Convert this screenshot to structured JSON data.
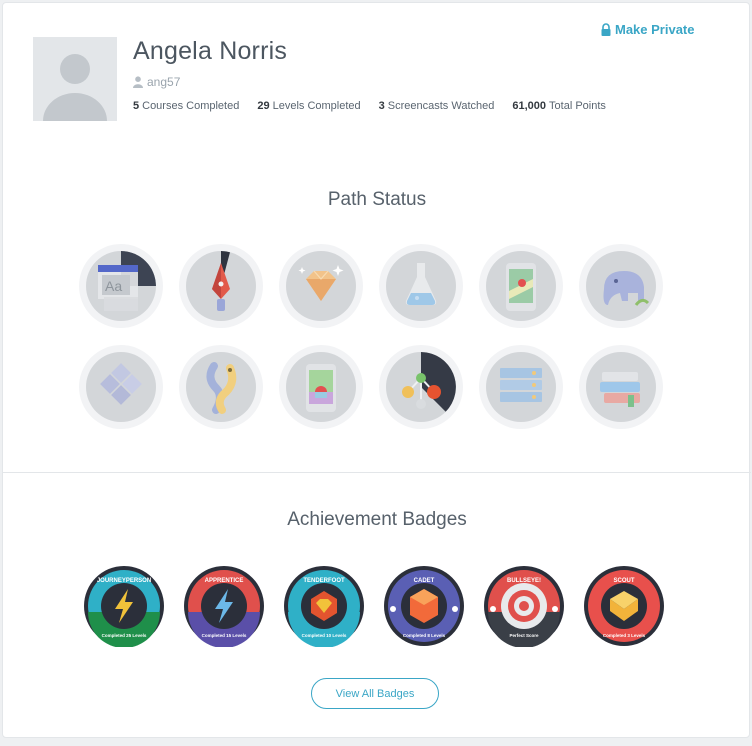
{
  "profile": {
    "name": "Angela Norris",
    "username": "ang57",
    "privacy_action": "Make Private",
    "stats": [
      {
        "value": "5",
        "label": "Courses Completed"
      },
      {
        "value": "29",
        "label": "Levels Completed"
      },
      {
        "value": "3",
        "label": "Screencasts Watched"
      },
      {
        "value": "61,000",
        "label": "Total Points"
      }
    ]
  },
  "path_status": {
    "title": "Path Status",
    "paths": [
      {
        "icon": "typography-icon",
        "progress": 0.25,
        "accent": "#4a5ec7"
      },
      {
        "icon": "pen-tool-icon",
        "progress": 0.08,
        "accent": "#e35050"
      },
      {
        "icon": "ruby-gem-icon",
        "progress": 0,
        "accent": "#d0d3d6"
      },
      {
        "icon": "flask-icon",
        "progress": 0,
        "accent": "#d0d3d6"
      },
      {
        "icon": "mobile-map-icon",
        "progress": 0,
        "accent": "#d0d3d6"
      },
      {
        "icon": "elephant-icon",
        "progress": 0,
        "accent": "#d0d3d6"
      },
      {
        "icon": "diamond-tiles-icon",
        "progress": 0,
        "accent": "#d0d3d6"
      },
      {
        "icon": "python-snakes-icon",
        "progress": 0,
        "accent": "#d0d3d6"
      },
      {
        "icon": "mobile-app-icon",
        "progress": 0,
        "accent": "#d0d3d6"
      },
      {
        "icon": "molecule-icon",
        "progress": 0.3,
        "accent": "#f0773b"
      },
      {
        "icon": "server-rack-icon",
        "progress": 0,
        "accent": "#d0d3d6"
      },
      {
        "icon": "books-stack-icon",
        "progress": 0,
        "accent": "#d0d3d6"
      }
    ]
  },
  "achievements": {
    "title": "Achievement Badges",
    "view_all_label": "View All Badges",
    "badges": [
      {
        "title": "JOURNEYPERSON",
        "subtitle": "Completed 25 Levels",
        "ring": "#2fb0c7",
        "band": "#1f8f4a",
        "emblem": "lightning-icon"
      },
      {
        "title": "APPRENTICE",
        "subtitle": "Completed 15 Levels",
        "ring": "#e0504c",
        "band": "#5a4fa8",
        "emblem": "lightning-icon"
      },
      {
        "title": "TENDERFOOT",
        "subtitle": "Completed 10 Levels",
        "ring": "#2fb0c7",
        "band": "#2fb0c7",
        "emblem": "gem-icon"
      },
      {
        "title": "CADET",
        "subtitle": "Completed 8 Levels",
        "ring": "#5a5fb4",
        "band": "#5a5fb4",
        "emblem": "gem-icon"
      },
      {
        "title": "BULLSEYE!",
        "subtitle": "Perfect Score",
        "ring": "#e0504c",
        "band": "#3a3f47",
        "emblem": "target-icon"
      },
      {
        "title": "SCOUT",
        "subtitle": "Completed 3 Levels",
        "ring": "#e8504c",
        "band": "#e8504c",
        "emblem": "chevron-icon"
      }
    ]
  }
}
